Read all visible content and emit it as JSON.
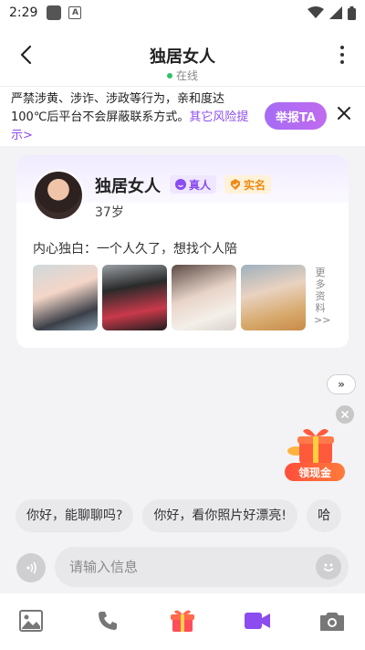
{
  "status_bar": {
    "time": "2:29",
    "notification_icons": [
      "square-icon",
      "a-box-icon"
    ],
    "system_icons": [
      "wifi-icon",
      "signal-icon",
      "battery-icon"
    ]
  },
  "header": {
    "title": "独居女人",
    "status": "在线",
    "status_color": "#32c26a"
  },
  "warning": {
    "text": "严禁涉黄、涉诈、涉政等行为，亲和度达100℃后平台不会屏蔽联系方式。",
    "link": "其它风险提示>",
    "report_label": "举报TA",
    "link_color": "#8b4cf0"
  },
  "profile": {
    "name": "独居女人",
    "badges": {
      "real": "真人",
      "verified": "实名"
    },
    "age": "37岁",
    "monologue": "内心独白：一个人久了，想找个人陪",
    "more_info": "更多资料>>",
    "photos": [
      "photo-1",
      "photo-2",
      "photo-3",
      "photo-4"
    ]
  },
  "floating": {
    "forward_label": "»",
    "gift_label": "领现金"
  },
  "quick_replies": [
    "你好，能聊聊吗?",
    "你好，看你照片好漂亮!",
    "哈"
  ],
  "input": {
    "placeholder": "请输入信息"
  },
  "toolbar": {
    "items": [
      "image-icon",
      "phone-icon",
      "gift-icon",
      "video-icon",
      "camera-icon"
    ],
    "accent": "#8b4cf0"
  }
}
